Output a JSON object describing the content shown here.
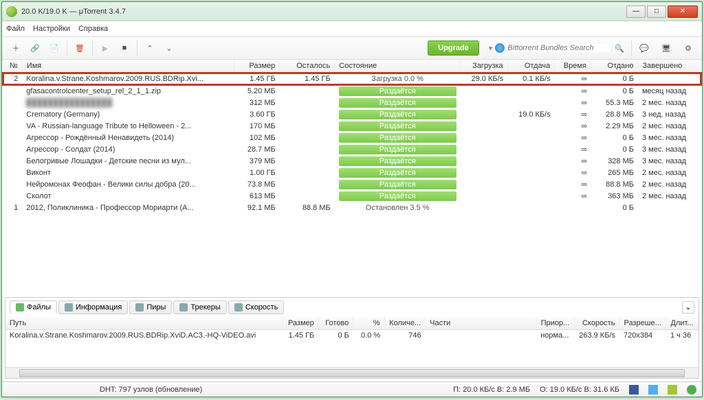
{
  "titlebar": {
    "title": "20.0 K/19.0 K — μTorrent 3.4.7"
  },
  "menu": {
    "file": "Файл",
    "settings": "Настройки",
    "help": "Справка"
  },
  "toolbar": {
    "upgrade": "Upgrade",
    "search_placeholder": "Bittorrent Bundles Search"
  },
  "columns": {
    "num": "№",
    "name": "Имя",
    "size": "Размер",
    "remain": "Осталось",
    "status": "Состояние",
    "down": "Загрузка",
    "up": "Отдача",
    "time": "Время",
    "given": "Отдано",
    "done": "Завершено"
  },
  "torrents": [
    {
      "num": "2",
      "name": "Koralina.v.Strane.Koshmarov.2009.RUS.BDRip.Xvi...",
      "size": "1.45 ГБ",
      "remain": "1.45 ГБ",
      "status": "Загрузка 0.0 %",
      "statusType": "dl",
      "down": "29.0 КБ/s",
      "up": "0.1 КБ/s",
      "time": "∞",
      "given": "0 Б",
      "done": "",
      "hl": true
    },
    {
      "num": "",
      "name": "gfasacontrolcenter_setup_rel_2_1_1.zip",
      "size": "5.20 МБ",
      "remain": "",
      "status": "Раздаётся",
      "statusType": "seed",
      "down": "",
      "up": "",
      "time": "∞",
      "given": "0 Б",
      "done": "месяц назад"
    },
    {
      "num": "",
      "name": "",
      "blur": true,
      "size": "312 МБ",
      "remain": "",
      "status": "Раздаётся",
      "statusType": "seed",
      "down": "",
      "up": "",
      "time": "∞",
      "given": "55.3 МБ",
      "done": "2 мес. назад"
    },
    {
      "num": "",
      "name": "Crematory (Germany)",
      "size": "3.60 ГБ",
      "remain": "",
      "status": "Раздаётся",
      "statusType": "seed",
      "down": "",
      "up": "19.0 КБ/s",
      "time": "∞",
      "given": "28.8 МБ",
      "done": "3 нед. назад"
    },
    {
      "num": "",
      "name": "VA - Russian-language Tribute to Helloween - 2...",
      "size": "170 МБ",
      "remain": "",
      "status": "Раздаётся",
      "statusType": "seed",
      "down": "",
      "up": "",
      "time": "∞",
      "given": "2.29 МБ",
      "done": "2 мес. назад"
    },
    {
      "num": "",
      "name": "Агрессор - Рождённый Ненавидеть (2014)",
      "size": "102 МБ",
      "remain": "",
      "status": "Раздаётся",
      "statusType": "seed",
      "down": "",
      "up": "",
      "time": "∞",
      "given": "0 Б",
      "done": "3 мес. назад"
    },
    {
      "num": "",
      "name": "Агрессор - Солдат (2014)",
      "size": "28.7 МБ",
      "remain": "",
      "status": "Раздаётся",
      "statusType": "seed",
      "down": "",
      "up": "",
      "time": "∞",
      "given": "0 Б",
      "done": "3 мес. назад"
    },
    {
      "num": "",
      "name": "Белогривые Лошадки - Детские песни из мул...",
      "size": "379 МБ",
      "remain": "",
      "status": "Раздаётся",
      "statusType": "seed",
      "down": "",
      "up": "",
      "time": "∞",
      "given": "328 МБ",
      "done": "3 мес. назад"
    },
    {
      "num": "",
      "name": "Виконт",
      "size": "1.00 ГБ",
      "remain": "",
      "status": "Раздаётся",
      "statusType": "seed",
      "down": "",
      "up": "",
      "time": "∞",
      "given": "265 МБ",
      "done": "2 мес. назад"
    },
    {
      "num": "",
      "name": "Нейромонах Феофан - Велики силы добра (20...",
      "size": "73.8 МБ",
      "remain": "",
      "status": "Раздаётся",
      "statusType": "seed",
      "down": "",
      "up": "",
      "time": "∞",
      "given": "88.8 МБ",
      "done": "2 мес. назад"
    },
    {
      "num": "",
      "name": "Сколот",
      "size": "613 МБ",
      "remain": "",
      "status": "Раздаётся",
      "statusType": "seed",
      "down": "",
      "up": "",
      "time": "∞",
      "given": "363 МБ",
      "done": "2 мес. назад"
    },
    {
      "num": "1",
      "name": "2012, Поликлиника - Профессор Мориарти (А...",
      "size": "92.1 МБ",
      "remain": "88.8 МБ",
      "status": "Остановлен 3.5 %",
      "statusType": "stop",
      "down": "",
      "up": "",
      "time": "",
      "given": "0 Б",
      "done": ""
    }
  ],
  "tabs": {
    "files": "Файлы",
    "info": "Информация",
    "peers": "Пиры",
    "trackers": "Трекеры",
    "speed": "Скорость"
  },
  "fileCols": {
    "path": "Путь",
    "size": "Размер",
    "done": "Готово",
    "pct": "%",
    "pieces": "Количе...",
    "parts": "Части",
    "prio": "Приор...",
    "speed": "Скорость",
    "res": "Разреше...",
    "dur": "Длит..."
  },
  "files": [
    {
      "path": "Koralina.v.Strane.Koshmarov.2009.RUS.BDRip.XviD.AC3.-HQ-ViDEO.avi",
      "size": "1.45 ГБ",
      "done": "0 Б",
      "pct": "0.0 %",
      "pieces": "746",
      "parts": "",
      "prio": "норма...",
      "speed": "263.9 КБ/s",
      "res": "720x384",
      "dur": "1 ч 36"
    }
  ],
  "statusbar": {
    "dht": "DHT: 797 узлов (обновление)",
    "down": "П: 20.0 КБ/с В: 2.9 МБ",
    "up": "О: 19.0 КБ/с В: 31.6 КБ"
  }
}
